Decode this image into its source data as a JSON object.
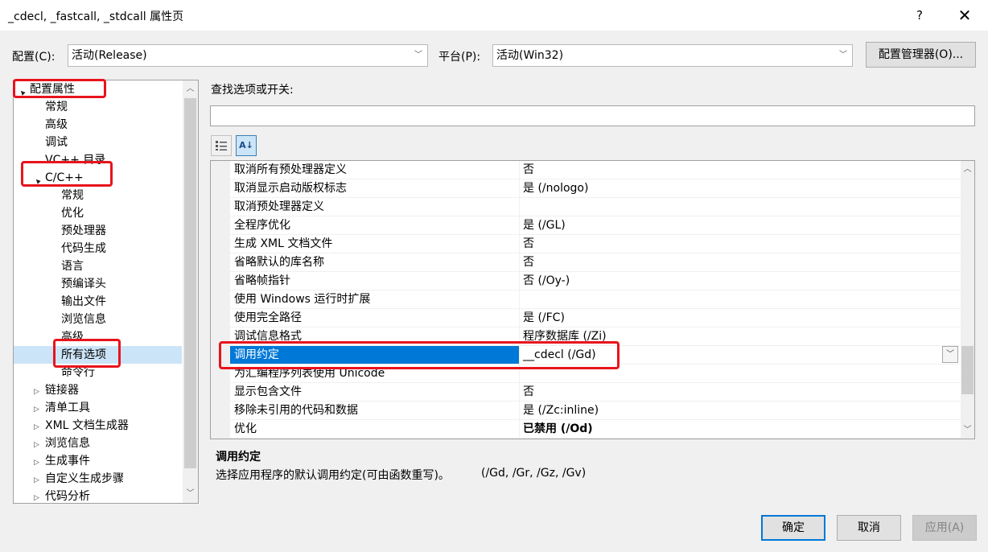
{
  "window": {
    "title": "_cdecl, _fastcall, _stdcall 属性页",
    "help_glyph": "?",
    "close_glyph": "✕"
  },
  "header": {
    "config_label": "配置(C):",
    "config_value": "活动(Release)",
    "platform_label": "平台(P):",
    "platform_value": "活动(Win32)",
    "config_manager_label": "配置管理器(O)..."
  },
  "search": {
    "label": "查找选项或开关:",
    "value": ""
  },
  "toolbar": {
    "categorized_icon": "categorized-view-icon",
    "alphabetical_icon": "alphabetical-sort-icon",
    "alphabetical_text": "A↓"
  },
  "tree": {
    "items": [
      {
        "label": "配置属性",
        "level": 0,
        "expander": "▲"
      },
      {
        "label": "常规",
        "level": 1,
        "expander": ""
      },
      {
        "label": "高级",
        "level": 1,
        "expander": ""
      },
      {
        "label": "调试",
        "level": 1,
        "expander": ""
      },
      {
        "label": "VC++ 目录",
        "level": 1,
        "expander": ""
      },
      {
        "label": "C/C++",
        "level": 1,
        "expander": "▲"
      },
      {
        "label": "常规",
        "level": 2,
        "expander": ""
      },
      {
        "label": "优化",
        "level": 2,
        "expander": ""
      },
      {
        "label": "预处理器",
        "level": 2,
        "expander": ""
      },
      {
        "label": "代码生成",
        "level": 2,
        "expander": ""
      },
      {
        "label": "语言",
        "level": 2,
        "expander": ""
      },
      {
        "label": "预编译头",
        "level": 2,
        "expander": ""
      },
      {
        "label": "输出文件",
        "level": 2,
        "expander": ""
      },
      {
        "label": "浏览信息",
        "level": 2,
        "expander": ""
      },
      {
        "label": "高级",
        "level": 2,
        "expander": ""
      },
      {
        "label": "所有选项",
        "level": 2,
        "expander": "",
        "selected": true
      },
      {
        "label": "命令行",
        "level": 2,
        "expander": ""
      },
      {
        "label": "链接器",
        "level": 1,
        "expander": "▷"
      },
      {
        "label": "清单工具",
        "level": 1,
        "expander": "▷"
      },
      {
        "label": "XML 文档生成器",
        "level": 1,
        "expander": "▷"
      },
      {
        "label": "浏览信息",
        "level": 1,
        "expander": "▷"
      },
      {
        "label": "生成事件",
        "level": 1,
        "expander": "▷"
      },
      {
        "label": "自定义生成步骤",
        "level": 1,
        "expander": "▷"
      },
      {
        "label": "代码分析",
        "level": 1,
        "expander": "▷"
      }
    ]
  },
  "grid": {
    "rows": [
      {
        "name": "取消所有预处理器定义",
        "value": "否"
      },
      {
        "name": "取消显示启动版权标志",
        "value": "是 (/nologo)"
      },
      {
        "name": "取消预处理器定义",
        "value": ""
      },
      {
        "name": "全程序优化",
        "value": "是 (/GL)"
      },
      {
        "name": "生成 XML 文档文件",
        "value": "否"
      },
      {
        "name": "省略默认的库名称",
        "value": "否"
      },
      {
        "name": "省略帧指针",
        "value": "否 (/Oy-)"
      },
      {
        "name": "使用 Windows 运行时扩展",
        "value": ""
      },
      {
        "name": "使用完全路径",
        "value": "是 (/FC)"
      },
      {
        "name": "调试信息格式",
        "value": "程序数据库 (/Zi)"
      },
      {
        "name": "调用约定",
        "value": "__cdecl (/Gd)",
        "selected": true
      },
      {
        "name": "为汇编程序列表使用 Unicode",
        "value": ""
      },
      {
        "name": "显示包含文件",
        "value": "否"
      },
      {
        "name": "移除未引用的代码和数据",
        "value": "是 (/Zc:inline)"
      },
      {
        "name": "优化",
        "value": "已禁用 (/Od)",
        "bold": true
      }
    ]
  },
  "description": {
    "title": "调用约定",
    "text": "选择应用程序的默认调用约定(可由函数重写)。",
    "switches": "(/Gd, /Gr, /Gz, /Gv)"
  },
  "footer": {
    "ok_label": "确定",
    "cancel_label": "取消",
    "apply_label": "应用(A)"
  },
  "colors": {
    "selection_blue": "#0078d7",
    "tree_selection": "#cce4f7",
    "annotation_red": "#e8141c"
  }
}
